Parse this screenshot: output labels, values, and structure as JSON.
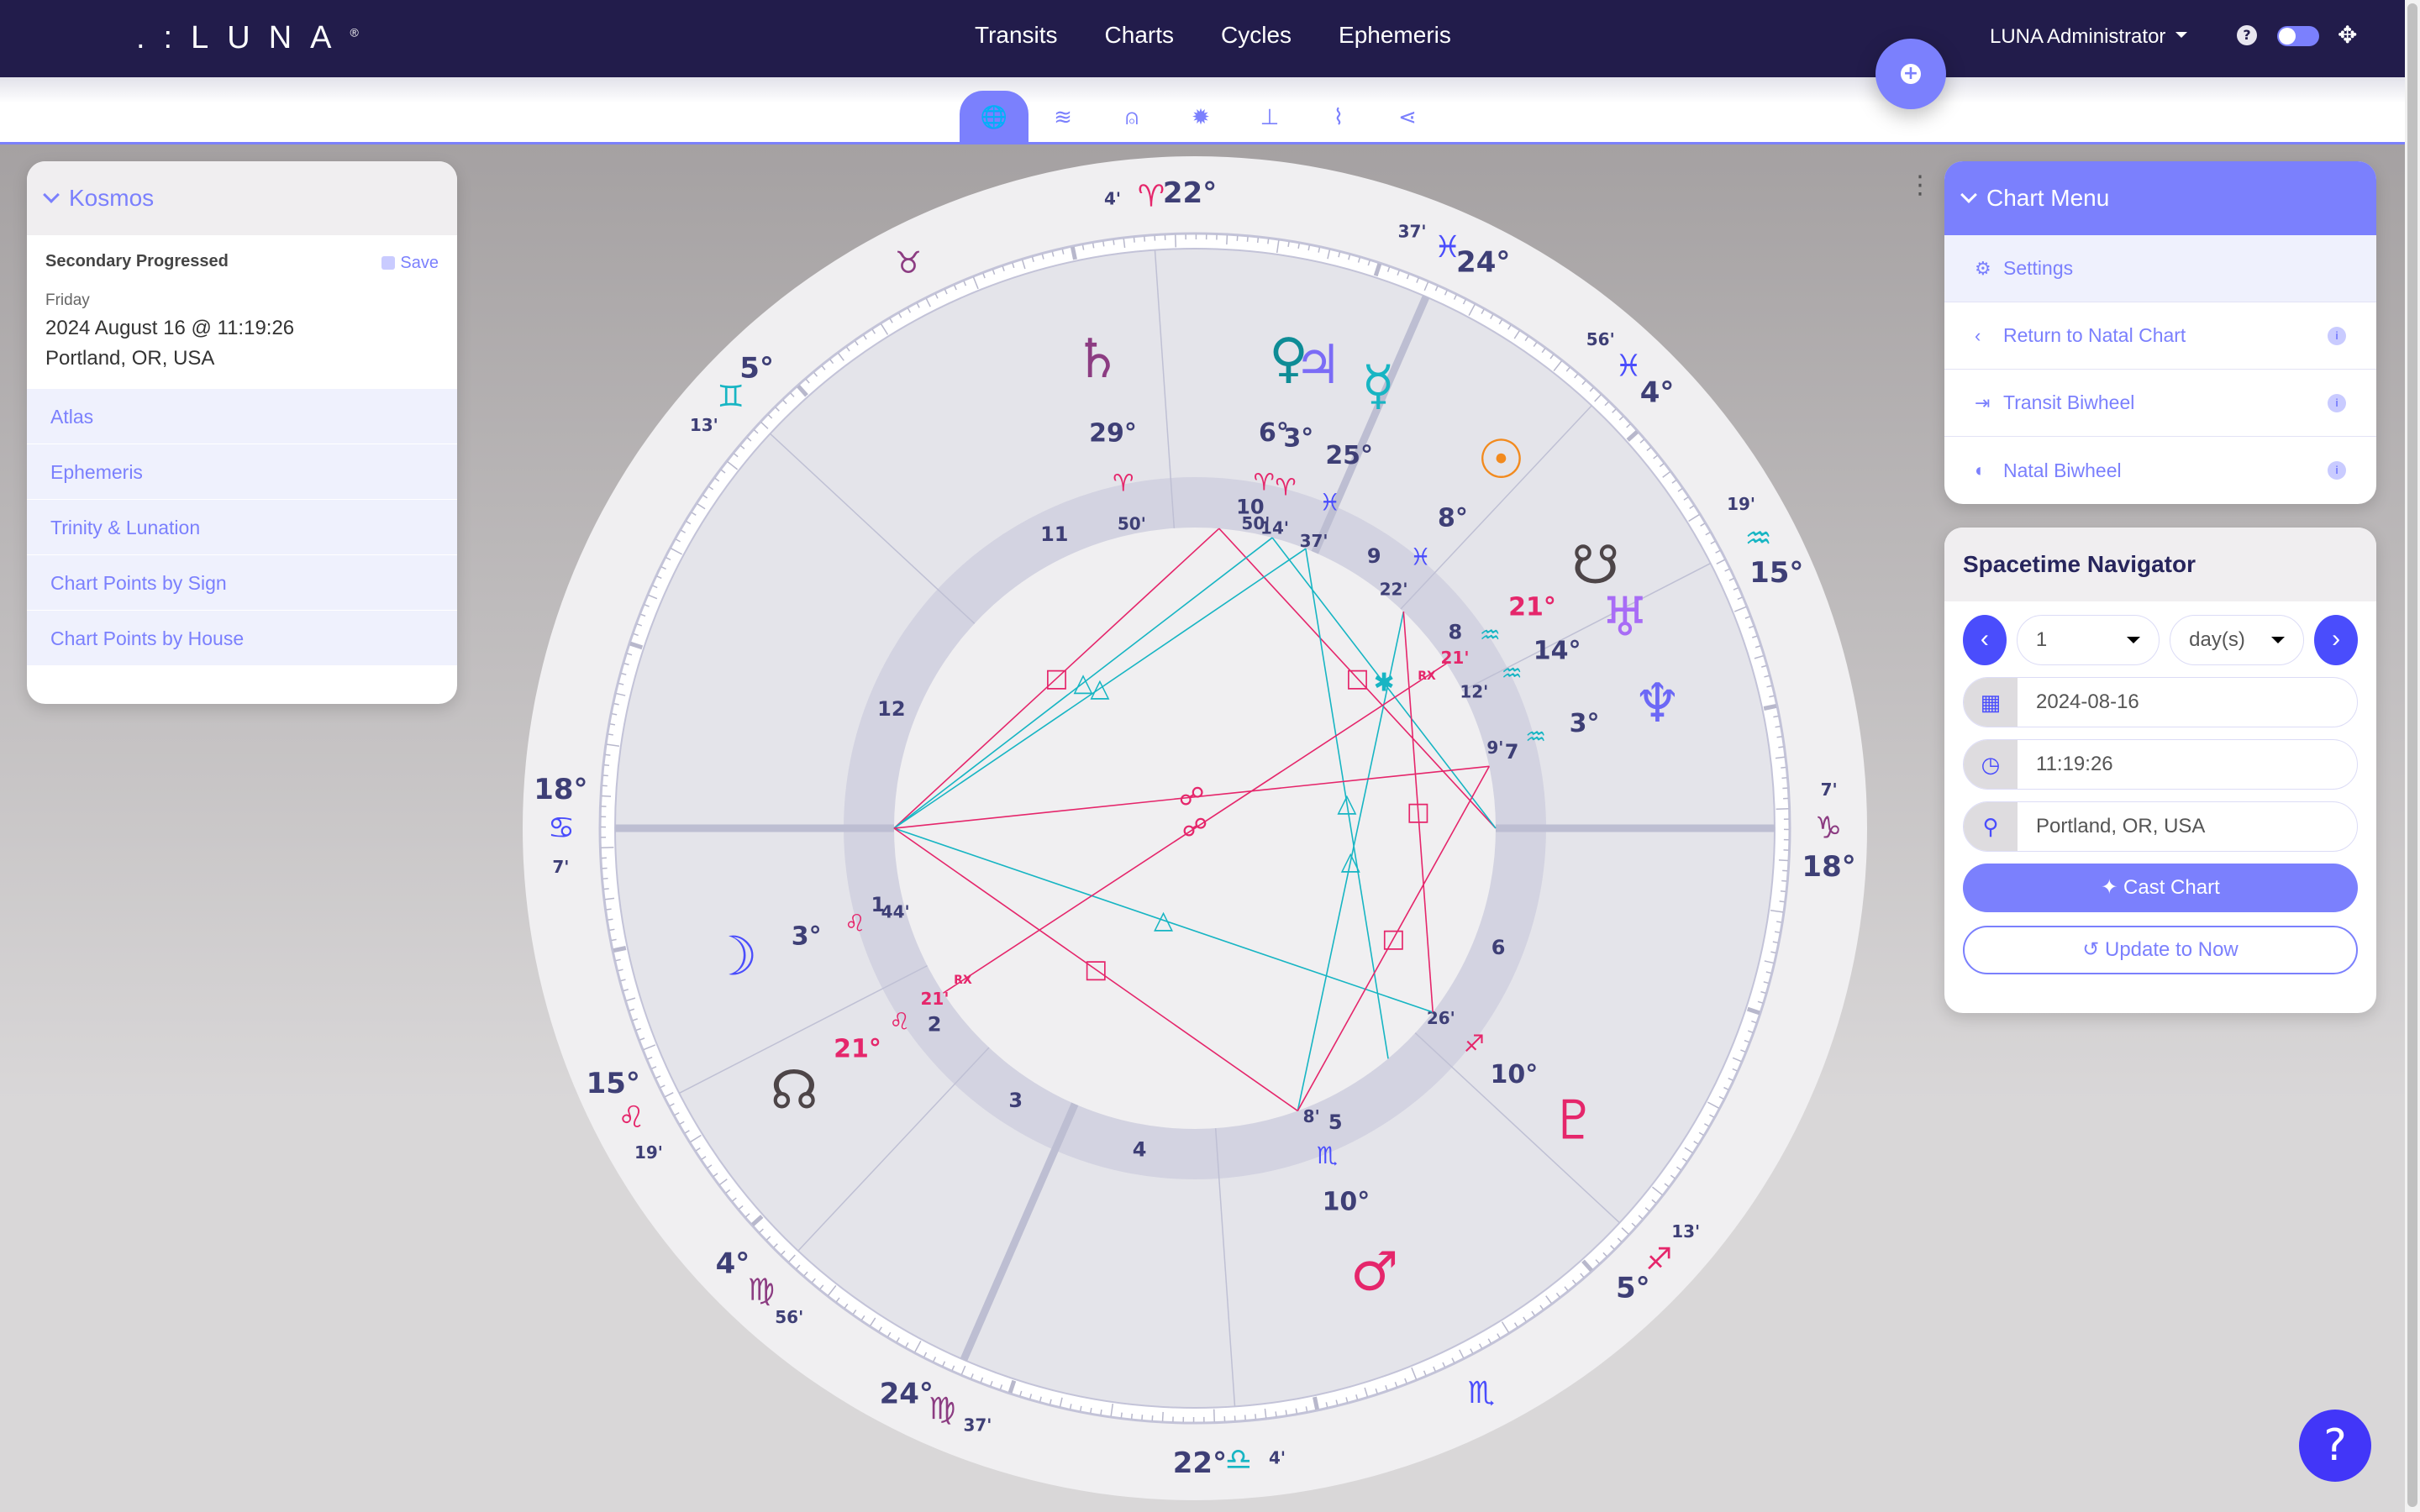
{
  "app": {
    "brand": ".:LUNA",
    "brand_mark": "®"
  },
  "nav": {
    "items": [
      "Transits",
      "Charts",
      "Cycles",
      "Ephemeris"
    ],
    "user": "LUNA Administrator"
  },
  "icons": {
    "help_small": "?",
    "fullscreen": "✥",
    "add": "+"
  },
  "subtabs": [
    {
      "name": "globe",
      "glyph": "🌐",
      "active": true
    },
    {
      "name": "layers",
      "glyph": "≋"
    },
    {
      "name": "compass-drafting",
      "glyph": "⍝"
    },
    {
      "name": "sun-burst",
      "glyph": "✹"
    },
    {
      "name": "sitemap",
      "glyph": "⊥"
    },
    {
      "name": "paperclip",
      "glyph": "⌇"
    },
    {
      "name": "share",
      "glyph": "⋖"
    }
  ],
  "kosmos": {
    "title": "Kosmos",
    "chart_type": "Secondary Progressed",
    "save_label": "Save",
    "weekday": "Friday",
    "datetime": "2024 August 16 @ 11:19:26",
    "place": "Portland, OR, USA",
    "links": [
      "Atlas",
      "Ephemeris",
      "Trinity & Lunation",
      "Chart Points by Sign",
      "Chart Points by House"
    ]
  },
  "chart_menu": {
    "title": "Chart Menu",
    "items": [
      {
        "label": "Settings",
        "icon": "⚙",
        "info": false
      },
      {
        "label": "Return to Natal Chart",
        "icon": "‹",
        "info": true
      },
      {
        "label": "Transit Biwheel",
        "icon": "⇥",
        "info": true
      },
      {
        "label": "Natal Biwheel",
        "icon": "◐",
        "info": true
      }
    ],
    "info_glyph": "i"
  },
  "navigator": {
    "title": "Spacetime Navigator",
    "step_value": "1",
    "step_unit": "day(s)",
    "prev": "‹",
    "next": "›",
    "date": "2024-08-16",
    "time": "11:19:26",
    "location": "Portland, OR, USA",
    "cast_label": "Cast Chart",
    "update_label": "Update to Now",
    "date_icon": "▦",
    "time_icon": "◷",
    "location_icon": "⚲"
  },
  "help_glyph": "?",
  "kebab_glyph": "⋮",
  "colors": {
    "accent": "#7b80fd",
    "topbar": "#221c4b",
    "fire": "#e5266b",
    "water": "#4a4dfc",
    "air": "#17b5c3",
    "earth": "#8c3c82",
    "text": "#3e3f76"
  },
  "chart_data": {
    "type": "astrology-wheel",
    "ascendant": {
      "sign": "Cancer",
      "deg": 18,
      "min": 7
    },
    "signs": [
      {
        "name": "Aries",
        "glyph": "♈",
        "color": "#e5266b"
      },
      {
        "name": "Taurus",
        "glyph": "♉",
        "color": "#8c3c82"
      },
      {
        "name": "Gemini",
        "glyph": "♊",
        "color": "#17b5c3"
      },
      {
        "name": "Cancer",
        "glyph": "♋",
        "color": "#4a4dfc"
      },
      {
        "name": "Leo",
        "glyph": "♌",
        "color": "#e5266b"
      },
      {
        "name": "Virgo",
        "glyph": "♍",
        "color": "#8c3c82"
      },
      {
        "name": "Libra",
        "glyph": "♎",
        "color": "#17b5c3"
      },
      {
        "name": "Scorpio",
        "glyph": "♏",
        "color": "#4a4dfc"
      },
      {
        "name": "Sagittarius",
        "glyph": "♐",
        "color": "#e5266b"
      },
      {
        "name": "Capricorn",
        "glyph": "♑",
        "color": "#8c3c82"
      },
      {
        "name": "Aquarius",
        "glyph": "♒",
        "color": "#17b5c3"
      },
      {
        "name": "Pisces",
        "glyph": "♓",
        "color": "#4a4dfc"
      }
    ],
    "house_cusps": [
      {
        "house": 1,
        "sign": 3,
        "deg": 18,
        "min": 7
      },
      {
        "house": 2,
        "sign": 4,
        "deg": 15,
        "min": 19
      },
      {
        "house": 3,
        "sign": 5,
        "deg": 4,
        "min": 56
      },
      {
        "house": 4,
        "sign": 5,
        "deg": 24,
        "min": 37
      },
      {
        "house": 5,
        "sign": 6,
        "deg": 22,
        "min": 4
      },
      {
        "house": 6,
        "sign": 8,
        "deg": 5,
        "min": 13
      },
      {
        "house": 7,
        "sign": 9,
        "deg": 18,
        "min": 7
      },
      {
        "house": 8,
        "sign": 10,
        "deg": 15,
        "min": 19
      },
      {
        "house": 9,
        "sign": 11,
        "deg": 4,
        "min": 56
      },
      {
        "house": 10,
        "sign": 11,
        "deg": 24,
        "min": 37
      },
      {
        "house": 11,
        "sign": 0,
        "deg": 22,
        "min": 4
      },
      {
        "house": 12,
        "sign": 2,
        "deg": 5,
        "min": 13
      }
    ],
    "planets": [
      {
        "name": "Sun",
        "glyph": "☉",
        "color": "#f28a1e",
        "sign": 11,
        "deg": 8,
        "min": 22,
        "rx": false
      },
      {
        "name": "Moon",
        "glyph": "☽",
        "color": "#4a4dfc",
        "sign": 4,
        "deg": 3,
        "min": 44,
        "rx": false
      },
      {
        "name": "Mercury",
        "glyph": "☿",
        "color": "#17b5c3",
        "sign": 11,
        "deg": 25,
        "min": 37,
        "rx": false
      },
      {
        "name": "Venus",
        "glyph": "♀",
        "color": "#0e8c96",
        "sign": 0,
        "deg": 6,
        "min": 50,
        "rx": false
      },
      {
        "name": "Mars",
        "glyph": "♂",
        "color": "#e5266b",
        "sign": 7,
        "deg": 10,
        "min": 8,
        "rx": false
      },
      {
        "name": "Jupiter",
        "glyph": "♃",
        "color": "#7b6cf6",
        "sign": 0,
        "deg": 3,
        "min": 14,
        "rx": false
      },
      {
        "name": "Saturn",
        "glyph": "♄",
        "color": "#8c3c82",
        "sign": 0,
        "deg": 29,
        "min": 50,
        "rx": false
      },
      {
        "name": "Uranus",
        "glyph": "♅",
        "color": "#a86cf6",
        "sign": 10,
        "deg": 14,
        "min": 12,
        "rx": false
      },
      {
        "name": "Neptune",
        "glyph": "♆",
        "color": "#6c68f6",
        "sign": 10,
        "deg": 3,
        "min": 9,
        "rx": false
      },
      {
        "name": "Pluto",
        "glyph": "♇",
        "color": "#e5266b",
        "sign": 8,
        "deg": 10,
        "min": 26,
        "rx": false
      },
      {
        "name": "North Node",
        "glyph": "☊",
        "color": "#4d4548",
        "sign": 4,
        "deg": 21,
        "min": 21,
        "rx": true,
        "highlight": true
      },
      {
        "name": "South Node",
        "glyph": "☋",
        "color": "#4d4548",
        "sign": 10,
        "deg": 21,
        "min": 21,
        "rx": true,
        "highlight": true
      }
    ],
    "aspects": [
      {
        "type": "square",
        "color": "#e5266b",
        "from": 108.12,
        "to": 13.5
      },
      {
        "type": "square",
        "color": "#e5266b",
        "from": 13.5,
        "to": 288.12
      },
      {
        "type": "trine",
        "color": "#17b5c3",
        "from": 108.12,
        "to": 356.5
      },
      {
        "type": "trine",
        "color": "#17b5c3",
        "from": 108.12,
        "to": 3.2
      },
      {
        "type": "trine",
        "color": "#17b5c3",
        "from": 356.5,
        "to": 238.1
      },
      {
        "type": "sextile",
        "color": "#17b5c3",
        "from": 3.2,
        "to": 288.12
      },
      {
        "type": "trine",
        "color": "#17b5c3",
        "from": 108.12,
        "to": 250.4
      },
      {
        "type": "trine",
        "color": "#17b5c3",
        "from": 334.2,
        "to": 218.1
      },
      {
        "type": "opposition",
        "color": "#e5266b",
        "from": 108.12,
        "to": 300.0
      },
      {
        "type": "opposition",
        "color": "#e5266b",
        "from": 141.35,
        "to": 321.35
      },
      {
        "type": "square",
        "color": "#e5266b",
        "from": 108.12,
        "to": 218.1
      },
      {
        "type": "square",
        "color": "#e5266b",
        "from": 218.1,
        "to": 300.0
      },
      {
        "type": "square",
        "color": "#e5266b",
        "from": 334.2,
        "to": 250.4
      }
    ]
  }
}
